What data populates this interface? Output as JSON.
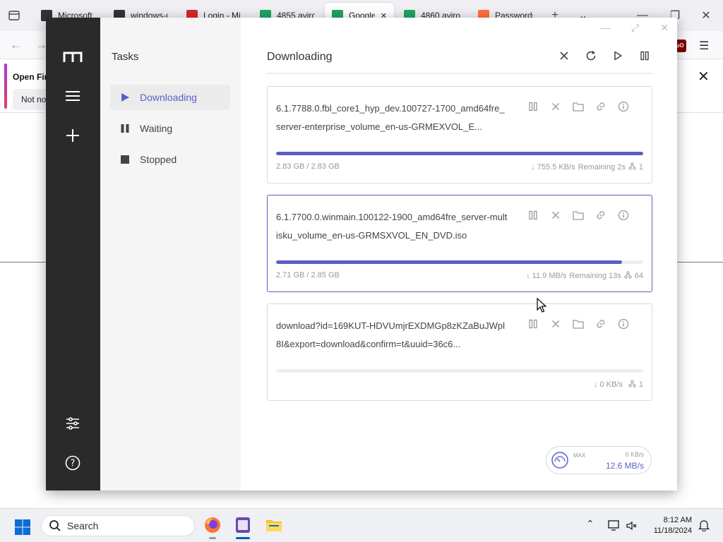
{
  "browser": {
    "tabs": [
      {
        "label": "Microsoft",
        "active": false,
        "favicon": "m-logo",
        "color": "#333333"
      },
      {
        "label": "windows-u",
        "active": false,
        "favicon": "m-logo",
        "color": "#333333"
      },
      {
        "label": "Login - Mi",
        "active": false,
        "favicon": "mega-logo",
        "color": "#d9272e"
      },
      {
        "label": "4855 aviro",
        "active": false,
        "favicon": "drive-logo",
        "color": "#1fa463"
      },
      {
        "label": "Google",
        "active": true,
        "favicon": "drive-logo",
        "color": "#1fa463"
      },
      {
        "label": "4860 aviro",
        "active": false,
        "favicon": "drive-logo",
        "color": "#1fa463"
      },
      {
        "label": "Passwords",
        "active": false,
        "favicon": "firefox-logo",
        "color": "#ff7139"
      }
    ],
    "notification": {
      "title": "Open Fir",
      "button": "Not no"
    }
  },
  "app": {
    "sidebar": {
      "title": "Tasks",
      "items": [
        {
          "label": "Downloading",
          "icon": "play-icon",
          "active": true
        },
        {
          "label": "Waiting",
          "icon": "pause-icon",
          "active": false
        },
        {
          "label": "Stopped",
          "icon": "stop-icon",
          "active": false
        }
      ]
    },
    "main": {
      "title": "Downloading",
      "tasks": [
        {
          "name": "6.1.7788.0.fbl_core1_hyp_dev.100727-1700_amd64fre_server-enterprise_volume_en-us-GRMEXVOL_E...",
          "progress": 1.0,
          "size": "2.83 GB / 2.83 GB",
          "speed": "↓ 755.5 KB/s",
          "remaining": "Remaining 2s",
          "connections": "1",
          "selected": false
        },
        {
          "name": "6.1.7700.0.winmain.100122-1900_amd64fre_server-multisku_volume_en-us-GRMSXVOL_EN_DVD.iso",
          "progress": 0.943,
          "size": "2.71 GB / 2.85 GB",
          "speed": "↓ 11.9 MB/s",
          "remaining": "Remaining 13s",
          "connections": "64",
          "selected": true
        },
        {
          "name": "download?id=169KUT-HDVUmjrEXDMGp8zKZaBuJWpl8I&export=download&confirm=t&uuid=36c6...",
          "progress": 0.0,
          "size": "",
          "speed": "↓ 0 KB/s",
          "remaining": "",
          "connections": "1",
          "selected": false
        }
      ],
      "speed_widget": {
        "max_label": "MAX",
        "upload": "0 KB/s",
        "download": "12.6 MB/s"
      }
    }
  },
  "taskbar": {
    "search": "Search",
    "time": "8:12 AM",
    "date": "11/18/2024"
  },
  "colors": {
    "accent": "#5b5fc7",
    "rail": "#2a2a2a"
  }
}
